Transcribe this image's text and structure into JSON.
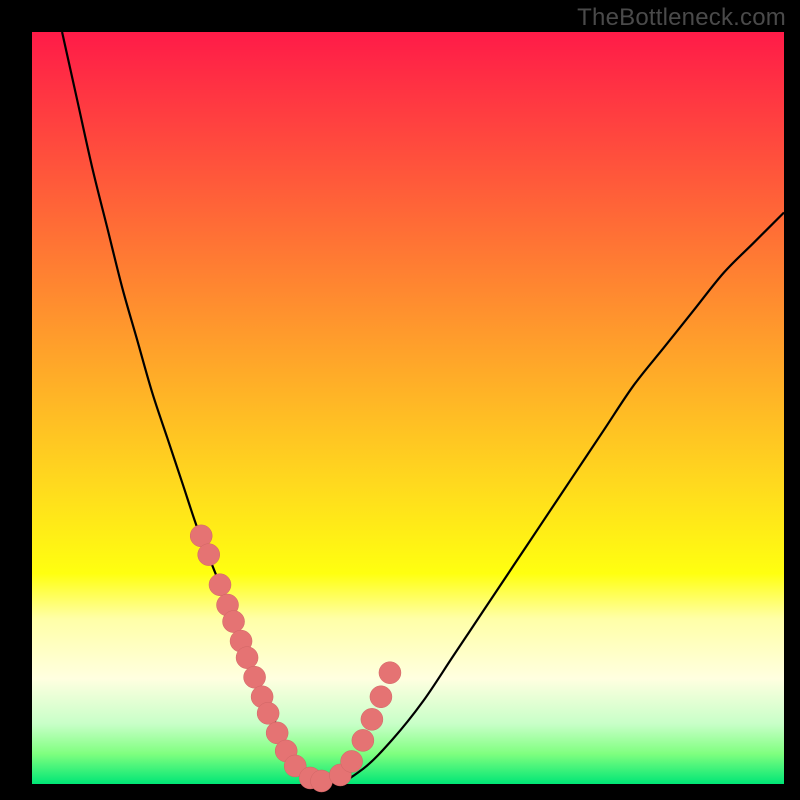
{
  "watermark": "TheBottleneck.com",
  "colors": {
    "frame": "#000000",
    "curve": "#000000",
    "marker_fill": "#e57373",
    "marker_stroke": "#d06565",
    "gradient_stops": [
      {
        "offset": 0.0,
        "color": "#ff1b48"
      },
      {
        "offset": 0.2,
        "color": "#ff5a3a"
      },
      {
        "offset": 0.4,
        "color": "#ff9a2c"
      },
      {
        "offset": 0.6,
        "color": "#ffd91e"
      },
      {
        "offset": 0.72,
        "color": "#ffff10"
      },
      {
        "offset": 0.78,
        "color": "#ffffa7"
      },
      {
        "offset": 0.86,
        "color": "#ffffe0"
      },
      {
        "offset": 0.92,
        "color": "#c8ffc8"
      },
      {
        "offset": 0.96,
        "color": "#7fff7f"
      },
      {
        "offset": 1.0,
        "color": "#00e676"
      }
    ]
  },
  "chart_data": {
    "type": "line",
    "title": "",
    "xlabel": "",
    "ylabel": "",
    "xlim": [
      0,
      100
    ],
    "ylim": [
      0,
      100
    ],
    "grid": false,
    "legend": false,
    "series": [
      {
        "name": "bottleneck-curve",
        "x": [
          4,
          6,
          8,
          10,
          12,
          14,
          16,
          18,
          20,
          22,
          24,
          26,
          28,
          30,
          32,
          34,
          36,
          40,
          44,
          48,
          52,
          56,
          60,
          64,
          68,
          72,
          76,
          80,
          84,
          88,
          92,
          96,
          100
        ],
        "y": [
          100,
          91,
          82,
          74,
          66,
          59,
          52,
          46,
          40,
          34,
          29,
          24,
          19,
          14,
          9,
          5,
          2,
          0,
          2,
          6,
          11,
          17,
          23,
          29,
          35,
          41,
          47,
          53,
          58,
          63,
          68,
          72,
          76
        ]
      }
    ],
    "markers": {
      "name": "highlight-points",
      "x": [
        22.5,
        23.5,
        25.0,
        26.0,
        26.8,
        27.8,
        28.6,
        29.6,
        30.6,
        31.4,
        32.6,
        33.8,
        35.0,
        37.0,
        38.5,
        41.0,
        42.5,
        44.0,
        45.2,
        46.4,
        47.6
      ],
      "y": [
        33.0,
        30.5,
        26.5,
        23.8,
        21.6,
        19.0,
        16.8,
        14.2,
        11.6,
        9.4,
        6.8,
        4.4,
        2.4,
        0.8,
        0.4,
        1.2,
        3.0,
        5.8,
        8.6,
        11.6,
        14.8
      ],
      "radius": 11
    }
  }
}
